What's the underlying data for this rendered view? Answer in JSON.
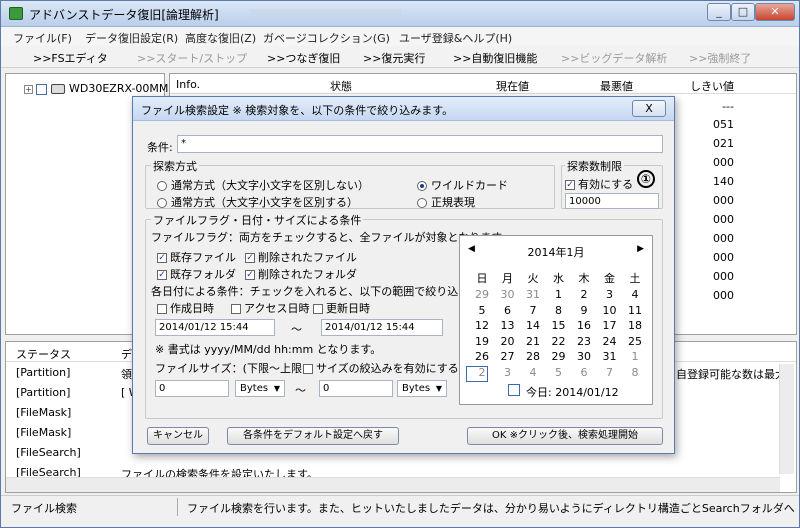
{
  "window": {
    "title": "アドバンストデータ復旧[論理解析]"
  },
  "menu": [
    "ファイル(F)",
    "データ復旧設定(R)",
    "高度な復旧(Z)",
    "ガベージコレクション(G)",
    "ユーザ登録&ヘルプ(H)"
  ],
  "toolbar": [
    {
      "label": ">>FSエディタ",
      "enabled": true
    },
    {
      "label": ">>スタート/ストップ",
      "enabled": false
    },
    {
      "label": ">>つなぎ復旧",
      "enabled": true
    },
    {
      "label": ">>復元実行",
      "enabled": true
    },
    {
      "label": ">>自動復旧機能",
      "enabled": true
    },
    {
      "label": ">>ビッグデータ解析",
      "enabled": false
    },
    {
      "label": ">>強制終了",
      "enabled": false
    }
  ],
  "tree": {
    "drive": "WD30EZRX-00MMM"
  },
  "grid": {
    "headers": [
      "Info.",
      "状態",
      "現在値",
      "最悪値",
      "しきい値"
    ],
    "thresholds": [
      "---",
      "051",
      "021",
      "000",
      "140",
      "000",
      "000",
      "000",
      "000",
      "000",
      "000"
    ]
  },
  "bottom": {
    "headers": [
      "ステータス",
      "デ"
    ],
    "rows": [
      {
        "status": "[Partition]",
        "msg": "領"
      },
      {
        "status": "[Partition]",
        "msg": "[ W"
      },
      {
        "status": "[FileMask]",
        "msg": ""
      },
      {
        "status": "[FileMask]",
        "msg": ""
      },
      {
        "status": "[FileSearch]",
        "msg": ""
      },
      {
        "status": "[FileSearch]",
        "msg": "ファイルの検索条件を設定いたします。"
      }
    ],
    "right_text": "自登録可能な数は最大"
  },
  "statusbar": {
    "left": "ファイル検索",
    "right": "ファイル検索を行います。また、ヒットいたしましたデータは、分かり易いようにディレクトリ構造ごとSearchフォルダへコピ"
  },
  "dialog": {
    "title": "ファイル検索設定 ※ 検索対象を、以下の条件で絞り込みます。",
    "condition_label": "条件:",
    "condition_value": "*",
    "search_mode": {
      "title": "探索方式",
      "opt1": "通常方式（大文字小文字を区別しない）",
      "opt2": "通常方式（大文字小文字を区別する）",
      "opt3": "ワイルドカード",
      "opt4": "正規表現"
    },
    "limit": {
      "title": "探索数制限",
      "enable": "有効にする",
      "value": "10000",
      "badge": "①"
    },
    "flags": {
      "title": "ファイルフラグ・日付・サイズによる条件",
      "note": "ファイルフラグ：両方をチェックすると、全ファイルが対象となります。",
      "existing_file": "既存ファイル",
      "deleted_file": "削除されたファイル",
      "existing_folder": "既存フォルダ",
      "deleted_folder": "削除されたフォルダ"
    },
    "date": {
      "note": "各日付による条件：チェックを入れると、以下の範囲で絞り込みます。",
      "created": "作成日時",
      "accessed": "アクセス日時",
      "updated": "更新日時",
      "from": "2014/01/12 15:44",
      "tilde": "～",
      "to": "2014/01/12 15:44",
      "format": "※ 書式は yyyy/MM/dd hh:mm となります。"
    },
    "size": {
      "label": "ファイルサイズ：(下限～上限)",
      "enable": "サイズの絞込みを有効にする",
      "min": "0",
      "unit1": "Bytes",
      "tilde": "～",
      "max": "0",
      "unit2": "Bytes"
    },
    "calendar": {
      "month": "2014年1月",
      "weekdays": [
        "日",
        "月",
        "火",
        "水",
        "木",
        "金",
        "土"
      ],
      "days": [
        [
          "29",
          "30",
          "31",
          "1",
          "2",
          "3",
          "4"
        ],
        [
          "5",
          "6",
          "7",
          "8",
          "9",
          "10",
          "11"
        ],
        [
          "12",
          "13",
          "14",
          "15",
          "16",
          "17",
          "18"
        ],
        [
          "19",
          "20",
          "21",
          "22",
          "23",
          "24",
          "25"
        ],
        [
          "26",
          "27",
          "28",
          "29",
          "30",
          "31",
          "1"
        ],
        [
          "2",
          "3",
          "4",
          "5",
          "6",
          "7",
          "8"
        ]
      ],
      "today_label": "今日: 2014/01/12"
    },
    "buttons": {
      "cancel": "キャンセル",
      "default": "各条件をデフォルト設定へ戻す",
      "ok": "OK ※クリック後、検索処理開始"
    },
    "close": "X"
  }
}
